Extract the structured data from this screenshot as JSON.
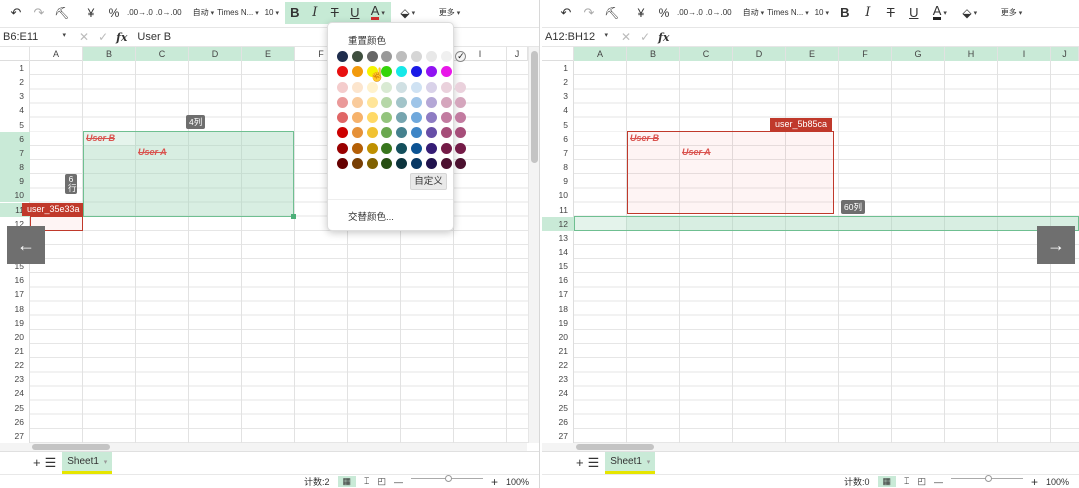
{
  "toolbar": {
    "undo_icon": "undo-icon",
    "redo_icon": "redo-icon",
    "format_painter_icon": "format-painter-icon",
    "currency": "¥",
    "percent": "%",
    "dec_inc": ".00→.0",
    "dec_dec": ".0→.00",
    "auto_format": "自动",
    "font_name": "Times N...",
    "font_size": "10",
    "bold": "B",
    "italic": "I",
    "strike": "T",
    "underline": "U",
    "font_color": "A",
    "fill_icon": "paint-bucket-icon",
    "more": "更多",
    "font_color_hex": "#d22e2e"
  },
  "left": {
    "name_box": "B6:E11",
    "formula_value": "User B",
    "columns": [
      "A",
      "B",
      "C",
      "D",
      "E",
      "F",
      "G",
      "H",
      "I",
      "J"
    ],
    "rows": [
      "1",
      "2",
      "3",
      "4",
      "5",
      "6",
      "7",
      "8",
      "9",
      "10",
      "11",
      "12",
      "13",
      "14",
      "15",
      "16",
      "17",
      "18",
      "19",
      "20",
      "21",
      "22",
      "23",
      "24",
      "25",
      "26",
      "27"
    ],
    "badge_cols": "4列",
    "badge_rows": "6行",
    "user_flag": "user_35e33a",
    "cell_user_b": "User B",
    "cell_user_a": "User A",
    "sheet_tab": "Sheet1",
    "status_count": "计数:2",
    "zoom": "100%"
  },
  "right": {
    "name_box": "A12:BH12",
    "columns": [
      "A",
      "B",
      "C",
      "D",
      "E",
      "F",
      "G",
      "H",
      "I",
      "J"
    ],
    "rows": [
      "1",
      "2",
      "3",
      "4",
      "5",
      "6",
      "7",
      "8",
      "9",
      "10",
      "11",
      "12",
      "13",
      "14",
      "15",
      "16",
      "17",
      "18",
      "19",
      "20",
      "21",
      "22",
      "23",
      "24",
      "25",
      "26",
      "27"
    ],
    "user_flag": "user_5b85ca",
    "badge_cols": "60列",
    "cell_user_b": "User B",
    "cell_user_a": "User A",
    "sheet_tab": "Sheet1",
    "status_count": "计数:0",
    "zoom": "100%"
  },
  "color_menu": {
    "reset_label": "重置颜色",
    "custom_label": "自定义",
    "alternate_label": "交替颜色...",
    "swatches": [
      "#1f2d4d",
      "#3f4f3f",
      "#666666",
      "#999999",
      "#bdbdbd",
      "#d6d6d6",
      "#e8e8e8",
      "#f0f0f0",
      "#ffffff",
      "#e81010",
      "#f29a0c",
      "#f5f500",
      "#35d40a",
      "#16e8e8",
      "#1a1ae6",
      "#9013f2",
      "#e817e8",
      "",
      "#f4cccc",
      "#fce5cd",
      "#fff2cc",
      "#d9ead3",
      "#d0e0e3",
      "#cfe2f3",
      "#d9d2e9",
      "#ead1dc",
      "#ead1dc",
      "#ea9999",
      "#f9cb9c",
      "#ffe599",
      "#b6d7a8",
      "#a2c4c9",
      "#9fc5e8",
      "#b4a7d6",
      "#d5a6bd",
      "#d5a6bd",
      "#e06666",
      "#f6b26b",
      "#ffd966",
      "#93c47d",
      "#76a5af",
      "#6fa8dc",
      "#8e7cc3",
      "#c27ba0",
      "#c27ba0",
      "#cc0000",
      "#e69138",
      "#f1c232",
      "#6aa84f",
      "#45818e",
      "#3d85c6",
      "#674ea7",
      "#a64d79",
      "#a64d79",
      "#990000",
      "#b45f06",
      "#bf9000",
      "#38761d",
      "#134f5c",
      "#0b5394",
      "#351c75",
      "#741b47",
      "#741b47",
      "#660000",
      "#783f04",
      "#7f6000",
      "#274e13",
      "#0c343d",
      "#073763",
      "#20124d",
      "#4c1130",
      "#4c1130"
    ],
    "checked_index": 8
  },
  "nav": {
    "left_arrow": "←",
    "right_arrow": "→"
  }
}
